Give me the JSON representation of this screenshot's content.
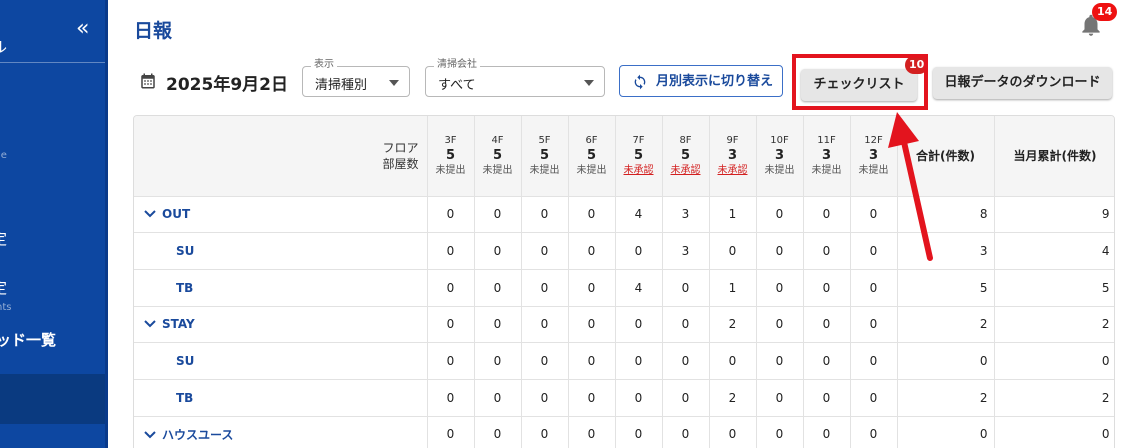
{
  "sidebar": {
    "collapse_glyph": "«",
    "fragments": [
      {
        "text": "ル",
        "kind": "big"
      },
      {
        "text": "le",
        "kind": "small"
      },
      {
        "text": "定",
        "kind": "big"
      },
      {
        "text": "定",
        "kind": "big"
      },
      {
        "text": "nts",
        "kind": "small"
      },
      {
        "text": "ッド一覧",
        "kind": "big"
      }
    ]
  },
  "header": {
    "title": "日報",
    "notifications_count": "14"
  },
  "toolbar": {
    "date": "2025年9月2日",
    "display_select": {
      "label": "表示",
      "value": "清掃種別"
    },
    "company_select": {
      "label": "清掃会社",
      "value": "すべて"
    },
    "monthly_button": "月別表示に切り替え",
    "checklist_button": "チェックリスト",
    "checklist_badge": "10",
    "download_button": "日報データのダウンロード"
  },
  "table": {
    "corner_label_line1": "フロア",
    "corner_label_line2": "部屋数",
    "floors": [
      {
        "floor": "3F",
        "rooms": "5",
        "status": "未提出",
        "alert": false
      },
      {
        "floor": "4F",
        "rooms": "5",
        "status": "未提出",
        "alert": false
      },
      {
        "floor": "5F",
        "rooms": "5",
        "status": "未提出",
        "alert": false
      },
      {
        "floor": "6F",
        "rooms": "5",
        "status": "未提出",
        "alert": false
      },
      {
        "floor": "7F",
        "rooms": "5",
        "status": "未承認",
        "alert": true
      },
      {
        "floor": "8F",
        "rooms": "5",
        "status": "未承認",
        "alert": true
      },
      {
        "floor": "9F",
        "rooms": "3",
        "status": "未承認",
        "alert": true
      },
      {
        "floor": "10F",
        "rooms": "3",
        "status": "未提出",
        "alert": false
      },
      {
        "floor": "11F",
        "rooms": "3",
        "status": "未提出",
        "alert": false
      },
      {
        "floor": "12F",
        "rooms": "3",
        "status": "未提出",
        "alert": false
      }
    ],
    "total_header": "合計(件数)",
    "monthly_total_header": "当月累計(件数)",
    "rows": [
      {
        "name": "OUT",
        "group": true,
        "values": [
          "0",
          "0",
          "0",
          "0",
          "4",
          "3",
          "1",
          "0",
          "0",
          "0"
        ],
        "total": "8",
        "monthly": "9"
      },
      {
        "name": "SU",
        "group": false,
        "values": [
          "0",
          "0",
          "0",
          "0",
          "0",
          "3",
          "0",
          "0",
          "0",
          "0"
        ],
        "total": "3",
        "monthly": "4"
      },
      {
        "name": "TB",
        "group": false,
        "values": [
          "0",
          "0",
          "0",
          "0",
          "4",
          "0",
          "1",
          "0",
          "0",
          "0"
        ],
        "total": "5",
        "monthly": "5"
      },
      {
        "name": "STAY",
        "group": true,
        "values": [
          "0",
          "0",
          "0",
          "0",
          "0",
          "0",
          "2",
          "0",
          "0",
          "0"
        ],
        "total": "2",
        "monthly": "2"
      },
      {
        "name": "SU",
        "group": false,
        "values": [
          "0",
          "0",
          "0",
          "0",
          "0",
          "0",
          "0",
          "0",
          "0",
          "0"
        ],
        "total": "0",
        "monthly": "0"
      },
      {
        "name": "TB",
        "group": false,
        "values": [
          "0",
          "0",
          "0",
          "0",
          "0",
          "0",
          "2",
          "0",
          "0",
          "0"
        ],
        "total": "2",
        "monthly": "2"
      },
      {
        "name": "ハウスユース",
        "group": true,
        "values": [
          "0",
          "0",
          "0",
          "0",
          "0",
          "0",
          "0",
          "0",
          "0",
          "0"
        ],
        "total": "0",
        "monthly": "0"
      }
    ]
  },
  "colors": {
    "sidebar": "#0d47a1",
    "accent_blue": "#1a4a9c",
    "alert_red": "#d32020",
    "annotation_red": "#e3141e"
  }
}
